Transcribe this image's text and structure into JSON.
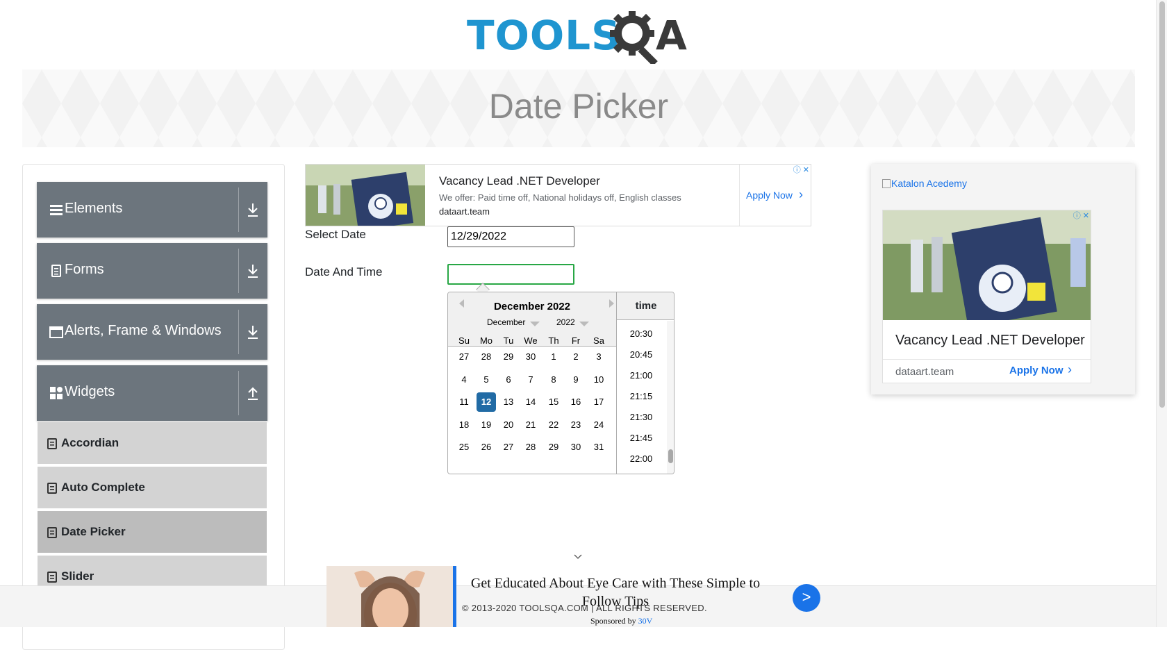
{
  "logo": {
    "part1": "TOOLS",
    "part2": "A"
  },
  "banner": {
    "title": "Date Picker"
  },
  "sidebar": {
    "groups": [
      {
        "label": "Elements",
        "icon": "hamburger-icon",
        "expanded": false
      },
      {
        "label": "Forms",
        "icon": "document-icon",
        "expanded": false
      },
      {
        "label": "Alerts, Frame & Windows",
        "icon": "window-icon",
        "expanded": false
      },
      {
        "label": "Widgets",
        "icon": "grid-icon",
        "expanded": true
      }
    ],
    "items": [
      {
        "label": "Accordian",
        "active": false
      },
      {
        "label": "Auto Complete",
        "active": false
      },
      {
        "label": "Date Picker",
        "active": true
      },
      {
        "label": "Slider",
        "active": false
      }
    ]
  },
  "ad_top": {
    "title": "Vacancy Lead .NET Developer",
    "description": "We offer: Paid time off, National holidays off, English classes",
    "domain": "dataart.team",
    "cta": "Apply Now"
  },
  "form": {
    "select_date_label": "Select Date",
    "select_date_value": "12/29/2022",
    "date_time_label": "Date And Time",
    "date_time_value": ""
  },
  "datepicker": {
    "current_month": "December 2022",
    "month_select": "December",
    "year_select": "2022",
    "weekdays": [
      "Su",
      "Mo",
      "Tu",
      "We",
      "Th",
      "Fr",
      "Sa"
    ],
    "weeks": [
      [
        "27",
        "28",
        "29",
        "30",
        "1",
        "2",
        "3"
      ],
      [
        "4",
        "5",
        "6",
        "7",
        "8",
        "9",
        "10"
      ],
      [
        "11",
        "12",
        "13",
        "14",
        "15",
        "16",
        "17"
      ],
      [
        "18",
        "19",
        "20",
        "21",
        "22",
        "23",
        "24"
      ],
      [
        "25",
        "26",
        "27",
        "28",
        "29",
        "30",
        "31"
      ]
    ],
    "selected_day": "12",
    "time_header": "time",
    "times": [
      "20:30",
      "20:45",
      "21:00",
      "21:15",
      "21:30",
      "21:45",
      "22:00"
    ]
  },
  "right_ad": {
    "image_alt": "Katalon Acedemy",
    "title": "Vacancy Lead .NET Developer",
    "domain": "dataart.team",
    "cta": "Apply Now"
  },
  "bottom_ad": {
    "title": "Get Educated About Eye Care with These Simple to Follow Tips",
    "sponsor_prefix": "Sponsored by",
    "sponsor_name": "30V",
    "button": ">"
  },
  "footer": {
    "text": "© 2013-2020 TOOLSQA.COM | ALL RIGHTS RESERVED."
  },
  "colors": {
    "brand_blue": "#1f95d0",
    "nav_gray": "#6c757d",
    "selected_day": "#216ba5",
    "focus_green": "#28a745",
    "link_blue": "#1a73e8"
  }
}
